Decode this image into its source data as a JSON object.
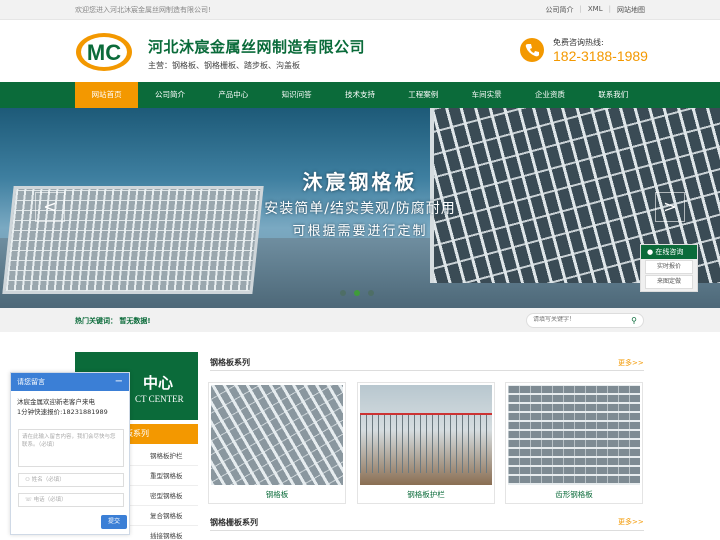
{
  "topbar": {
    "welcome": "欢迎您进入河北沐宸金属丝网制造有限公司!",
    "links": [
      "公司简介",
      "XML",
      "网站地图"
    ]
  },
  "header": {
    "logo_text": "MC",
    "company_name": "河北沐宸金属丝网制造有限公司",
    "main_products": "主营：钢格板、钢格栅板、踏步板、沟盖板",
    "hotline_label": "免费咨询热线:",
    "hotline_number": "182-3188-1989"
  },
  "nav": {
    "items": [
      "网站首页",
      "公司简介",
      "产品中心",
      "知识问答",
      "技术支持",
      "工程案例",
      "车间实景",
      "企业资质",
      "联系我们"
    ],
    "active_index": 0
  },
  "banner": {
    "title": "沐宸钢格板",
    "line1": "安装简单/结实美观/防腐耐用",
    "line2": "可根据需要进行定制",
    "prev": "<",
    "next": ">",
    "slides": 3,
    "active_slide": 1
  },
  "float_service": {
    "head": "在线咨询",
    "items": [
      "实时报价",
      "来图定做"
    ]
  },
  "hotbar": {
    "label": "热门关键词：  暂无数据!",
    "search_placeholder": "请填写关键字！"
  },
  "sidebar": {
    "title_cn": "中心",
    "title_en": "CT CENTER",
    "category": "板系列",
    "items": [
      "钢格板护栏",
      "重型钢格板",
      "密型钢格板",
      "复合钢格板",
      "插接钢格板"
    ]
  },
  "chat": {
    "head": "请您留言",
    "minimize": "−",
    "message": "沐宸金属欢迎新老客户来电\n1分钟快速报价:18231881989",
    "textarea_placeholder": "请在此输入留言内容，我们会尽快与您联系。（必填）",
    "name_placeholder": "姓名（必填）",
    "phone_placeholder": "电话（必填）",
    "submit": "提交"
  },
  "sections": [
    {
      "title": "钢格板系列",
      "more": "更多>>",
      "products": [
        "钢格板",
        "钢格板护栏",
        "齿形钢格板"
      ]
    },
    {
      "title": "钢格栅板系列",
      "more": "更多>>",
      "products": []
    }
  ],
  "colors": {
    "brand_green": "#0b6b3a",
    "accent_orange": "#f39800",
    "chat_blue": "#3b7fd6"
  }
}
